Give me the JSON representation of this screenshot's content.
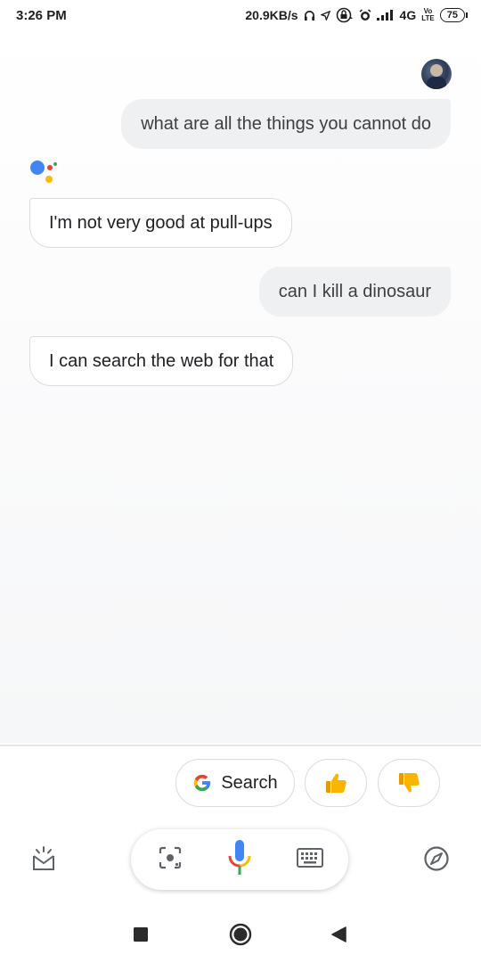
{
  "status_bar": {
    "time": "3:26 PM",
    "network_speed": "20.9KB/s",
    "signal": "4G",
    "volte_top": "Vo",
    "volte_bottom": "LTE",
    "battery": "75"
  },
  "conversation": {
    "messages": [
      {
        "role": "user",
        "text": "what are all the things you cannot do"
      },
      {
        "role": "assistant",
        "text": "I'm not very good at pull-ups"
      },
      {
        "role": "user",
        "text": "can I kill a dinosaur"
      },
      {
        "role": "assistant",
        "text": "I can search the web for that"
      }
    ]
  },
  "suggestions": {
    "search_label": "Search",
    "search_icon": "google-g-icon",
    "thumbs_up_icon": "thumbs-up-icon",
    "thumbs_down_icon": "thumbs-down-icon"
  },
  "bottom_bar": {
    "left_icon": "snapshot-icon",
    "lens_icon": "lens-icon",
    "mic_icon": "mic-icon",
    "keyboard_icon": "keyboard-icon",
    "right_icon": "compass-icon"
  },
  "nav_bar": {
    "recents": "square-icon",
    "home": "circle-icon",
    "back": "triangle-icon"
  },
  "colors": {
    "google_blue": "#4285F4",
    "google_red": "#EA4335",
    "google_yellow": "#FBBC05",
    "google_green": "#34A853",
    "emoji_yellow": "#F7B500"
  }
}
